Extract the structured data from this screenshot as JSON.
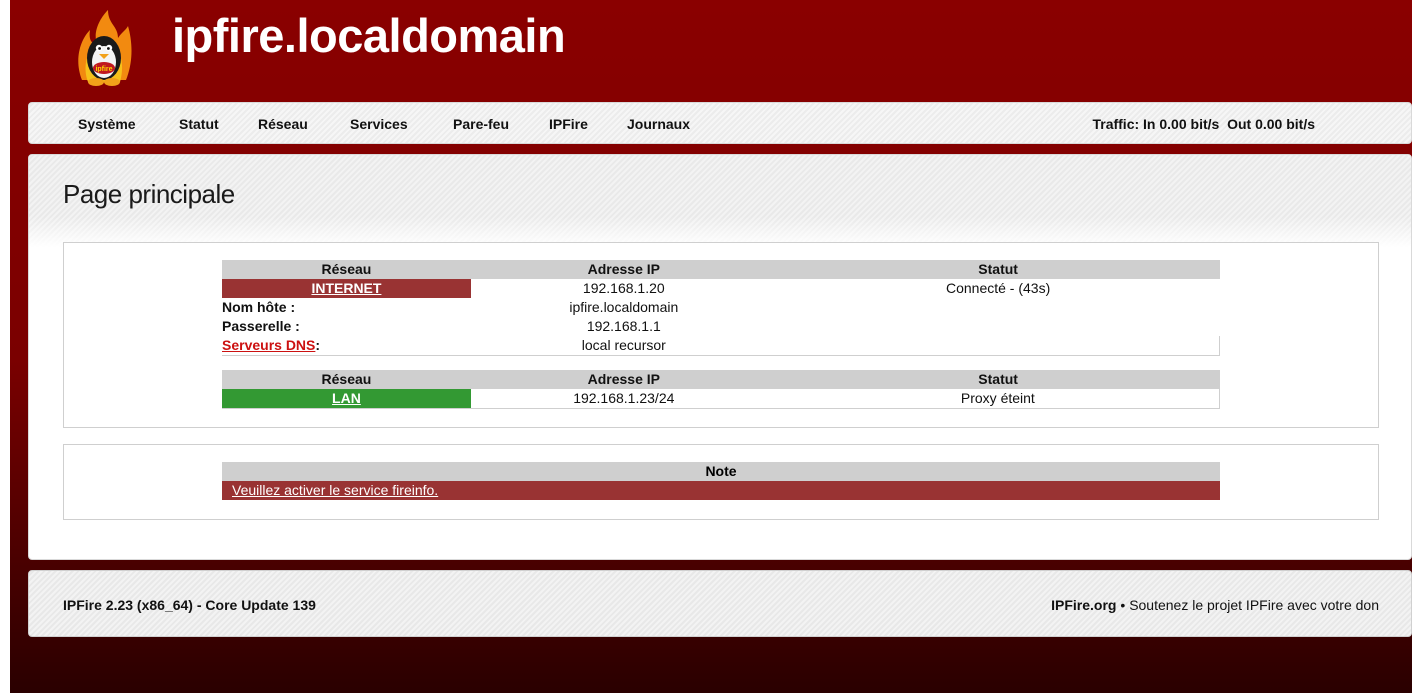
{
  "header": {
    "site_title": "ipfire.localdomain",
    "logo_text": "ipfire"
  },
  "nav": {
    "items": [
      {
        "label": "Système"
      },
      {
        "label": "Statut"
      },
      {
        "label": "Réseau"
      },
      {
        "label": "Services"
      },
      {
        "label": "Pare-feu"
      },
      {
        "label": "IPFire"
      },
      {
        "label": "Journaux"
      }
    ],
    "traffic_label": "Traffic:",
    "traffic_in": "In 0.00 bit/s",
    "traffic_out": "Out 0.00 bit/s"
  },
  "main": {
    "page_title": "Page principale",
    "internet_table": {
      "headers": [
        "Réseau",
        "Adresse IP",
        "Statut"
      ],
      "interface_name": "INTERNET",
      "interface_ip": "192.168.1.20",
      "interface_status": "Connecté - (43s)",
      "hostname_label": "Nom hôte :",
      "hostname_value": "ipfire.localdomain",
      "gateway_label": "Passerelle :",
      "gateway_value": "192.168.1.1",
      "dns_label": "Serveurs DNS",
      "dns_colon": ":",
      "dns_value": "local recursor"
    },
    "lan_table": {
      "headers": [
        "Réseau",
        "Adresse IP",
        "Statut"
      ],
      "interface_name": "LAN",
      "interface_ip": "192.168.1.23/24",
      "interface_status": "Proxy éteint"
    },
    "note_table": {
      "header": "Note",
      "message": "Veuillez activer le service fireinfo."
    }
  },
  "footer": {
    "version": "IPFire 2.23 (x86_64) - Core Update 139",
    "org_link": "IPFire.org",
    "separator": "•",
    "donate_text": "Soutenez le projet IPFire avec votre don"
  },
  "colors": {
    "brand_red": "#8a0000",
    "red_interface": "#993333",
    "green_interface": "#339933",
    "header_gray": "#cfcfcf",
    "dns_link": "#cc1111"
  }
}
